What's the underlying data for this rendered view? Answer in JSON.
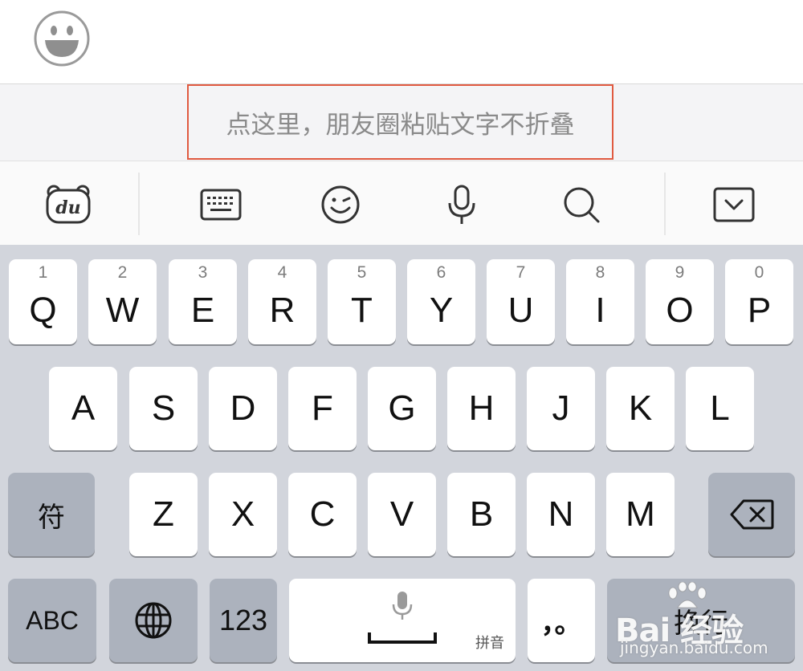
{
  "composer": {
    "emoji_icon": "smiley-face-icon",
    "paste_hint": "点这里，朋友圈粘贴文字不折叠",
    "paste_border_color": "#e05a40"
  },
  "toolbar": {
    "items": [
      {
        "name": "du-logo-icon"
      },
      {
        "name": "keyboard-icon"
      },
      {
        "name": "wink-emoji-icon"
      },
      {
        "name": "microphone-icon"
      },
      {
        "name": "search-icon"
      },
      {
        "name": "collapse-keyboard-icon"
      }
    ]
  },
  "keyboard": {
    "row1": [
      {
        "num": "1",
        "letter": "Q"
      },
      {
        "num": "2",
        "letter": "W"
      },
      {
        "num": "3",
        "letter": "E"
      },
      {
        "num": "4",
        "letter": "R"
      },
      {
        "num": "5",
        "letter": "T"
      },
      {
        "num": "6",
        "letter": "Y"
      },
      {
        "num": "7",
        "letter": "U"
      },
      {
        "num": "8",
        "letter": "I"
      },
      {
        "num": "9",
        "letter": "O"
      },
      {
        "num": "0",
        "letter": "P"
      }
    ],
    "row2": [
      "A",
      "S",
      "D",
      "F",
      "G",
      "H",
      "J",
      "K",
      "L"
    ],
    "row3_letters": [
      "Z",
      "X",
      "C",
      "V",
      "B",
      "N",
      "M"
    ],
    "symbol_key": "符",
    "abc_key": "ABC",
    "num_key": "123",
    "space_sublabel": "拼音",
    "punct_key": "，。",
    "return_key": "换行",
    "key_color": "#ffffff",
    "dark_key_color": "#acb2bd",
    "background": "#d2d5dc"
  },
  "watermark": {
    "main": "Bai 经验",
    "sub": "jingyan.baidu.com"
  }
}
